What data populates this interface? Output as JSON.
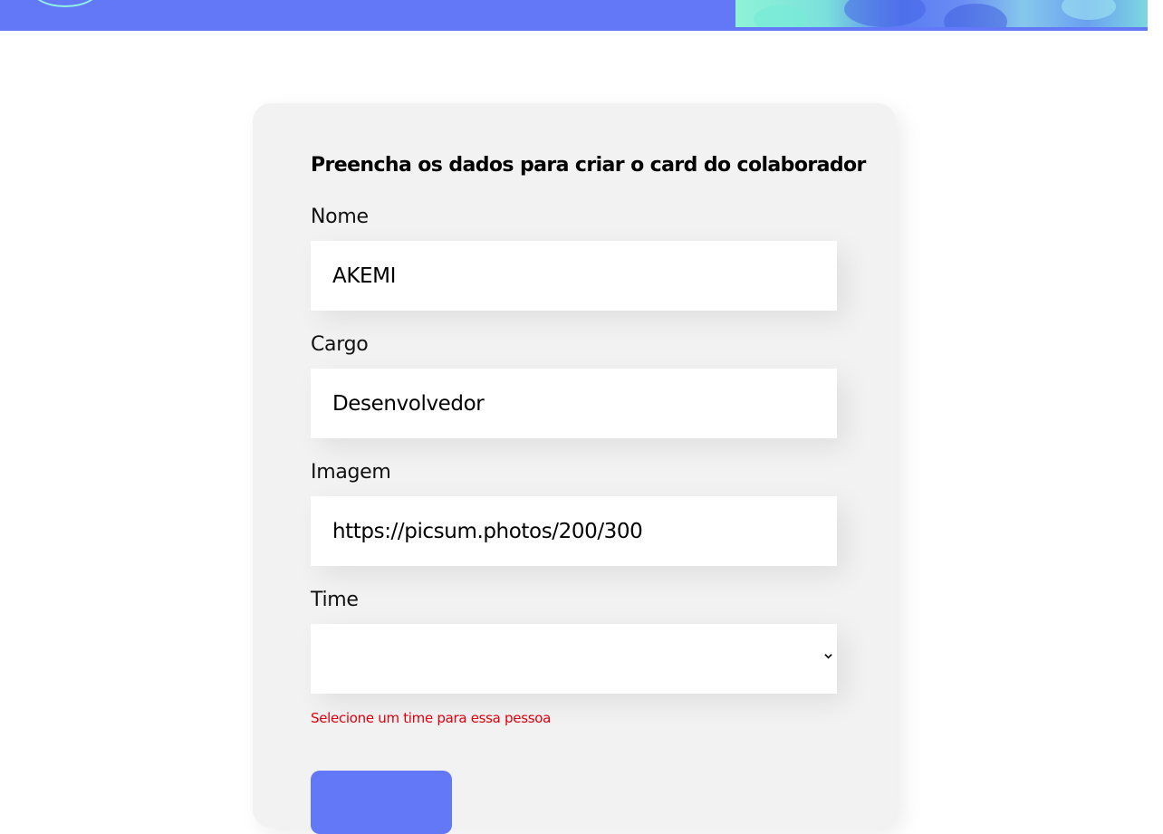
{
  "header": {
    "logo_icon": "circle-logo-icon",
    "banner_image_icon": "team-photo-banner",
    "brand_color": "#6278f7"
  },
  "form": {
    "title": "Preencha os dados para criar o card do colaborador",
    "fields": {
      "nome": {
        "label": "Nome",
        "value": "AKEMI"
      },
      "cargo": {
        "label": "Cargo",
        "value": "Desenvolvedor"
      },
      "imagem": {
        "label": "Imagem",
        "value": "https://picsum.photos/200/300"
      },
      "time": {
        "label": "Time",
        "selected": ""
      }
    },
    "error": "Selecione um time para essa pessoa",
    "error_color": "#e0000e",
    "submit_icon": "submit-button"
  }
}
